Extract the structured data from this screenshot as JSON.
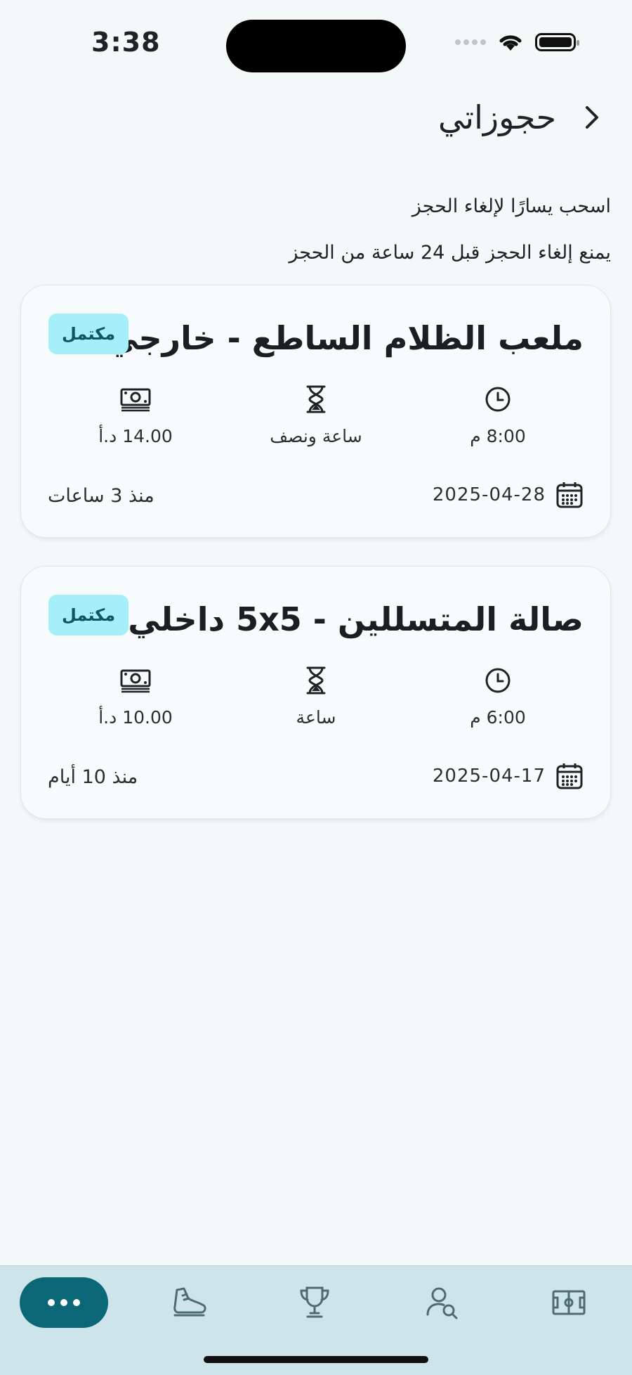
{
  "status": {
    "time": "3:38"
  },
  "header": {
    "title": "حجوزاتي"
  },
  "hints": [
    "اسحب يسارًا لإلغاء الحجز",
    "يمنع إلغاء الحجز قبل 24 ساعة من الحجز"
  ],
  "bookings": [
    {
      "title": "ملعب الظلام الساطع - خارجي",
      "status": "مكتمل",
      "time": "8:00 م",
      "duration": "ساعة ونصف",
      "price": "14.00 د.أ",
      "date": "2025-04-28",
      "ago": "منذ 3 ساعات"
    },
    {
      "title": "صالة المتسللين - 5x5 داخلي",
      "status": "مكتمل",
      "time": "6:00 م",
      "duration": "ساعة",
      "price": "10.00 د.أ",
      "date": "2025-04-17",
      "ago": "منذ 10 أيام"
    }
  ],
  "nav": {
    "items": [
      "more-icon",
      "shoe-icon",
      "trophy-icon",
      "user-search-icon",
      "field-icon"
    ],
    "accent": "#0b6776",
    "background": "#cde5ea"
  },
  "colors": {
    "badge_bg": "#a6eef8",
    "badge_text": "#0d5760",
    "page_bg": "#f3f8f9"
  }
}
